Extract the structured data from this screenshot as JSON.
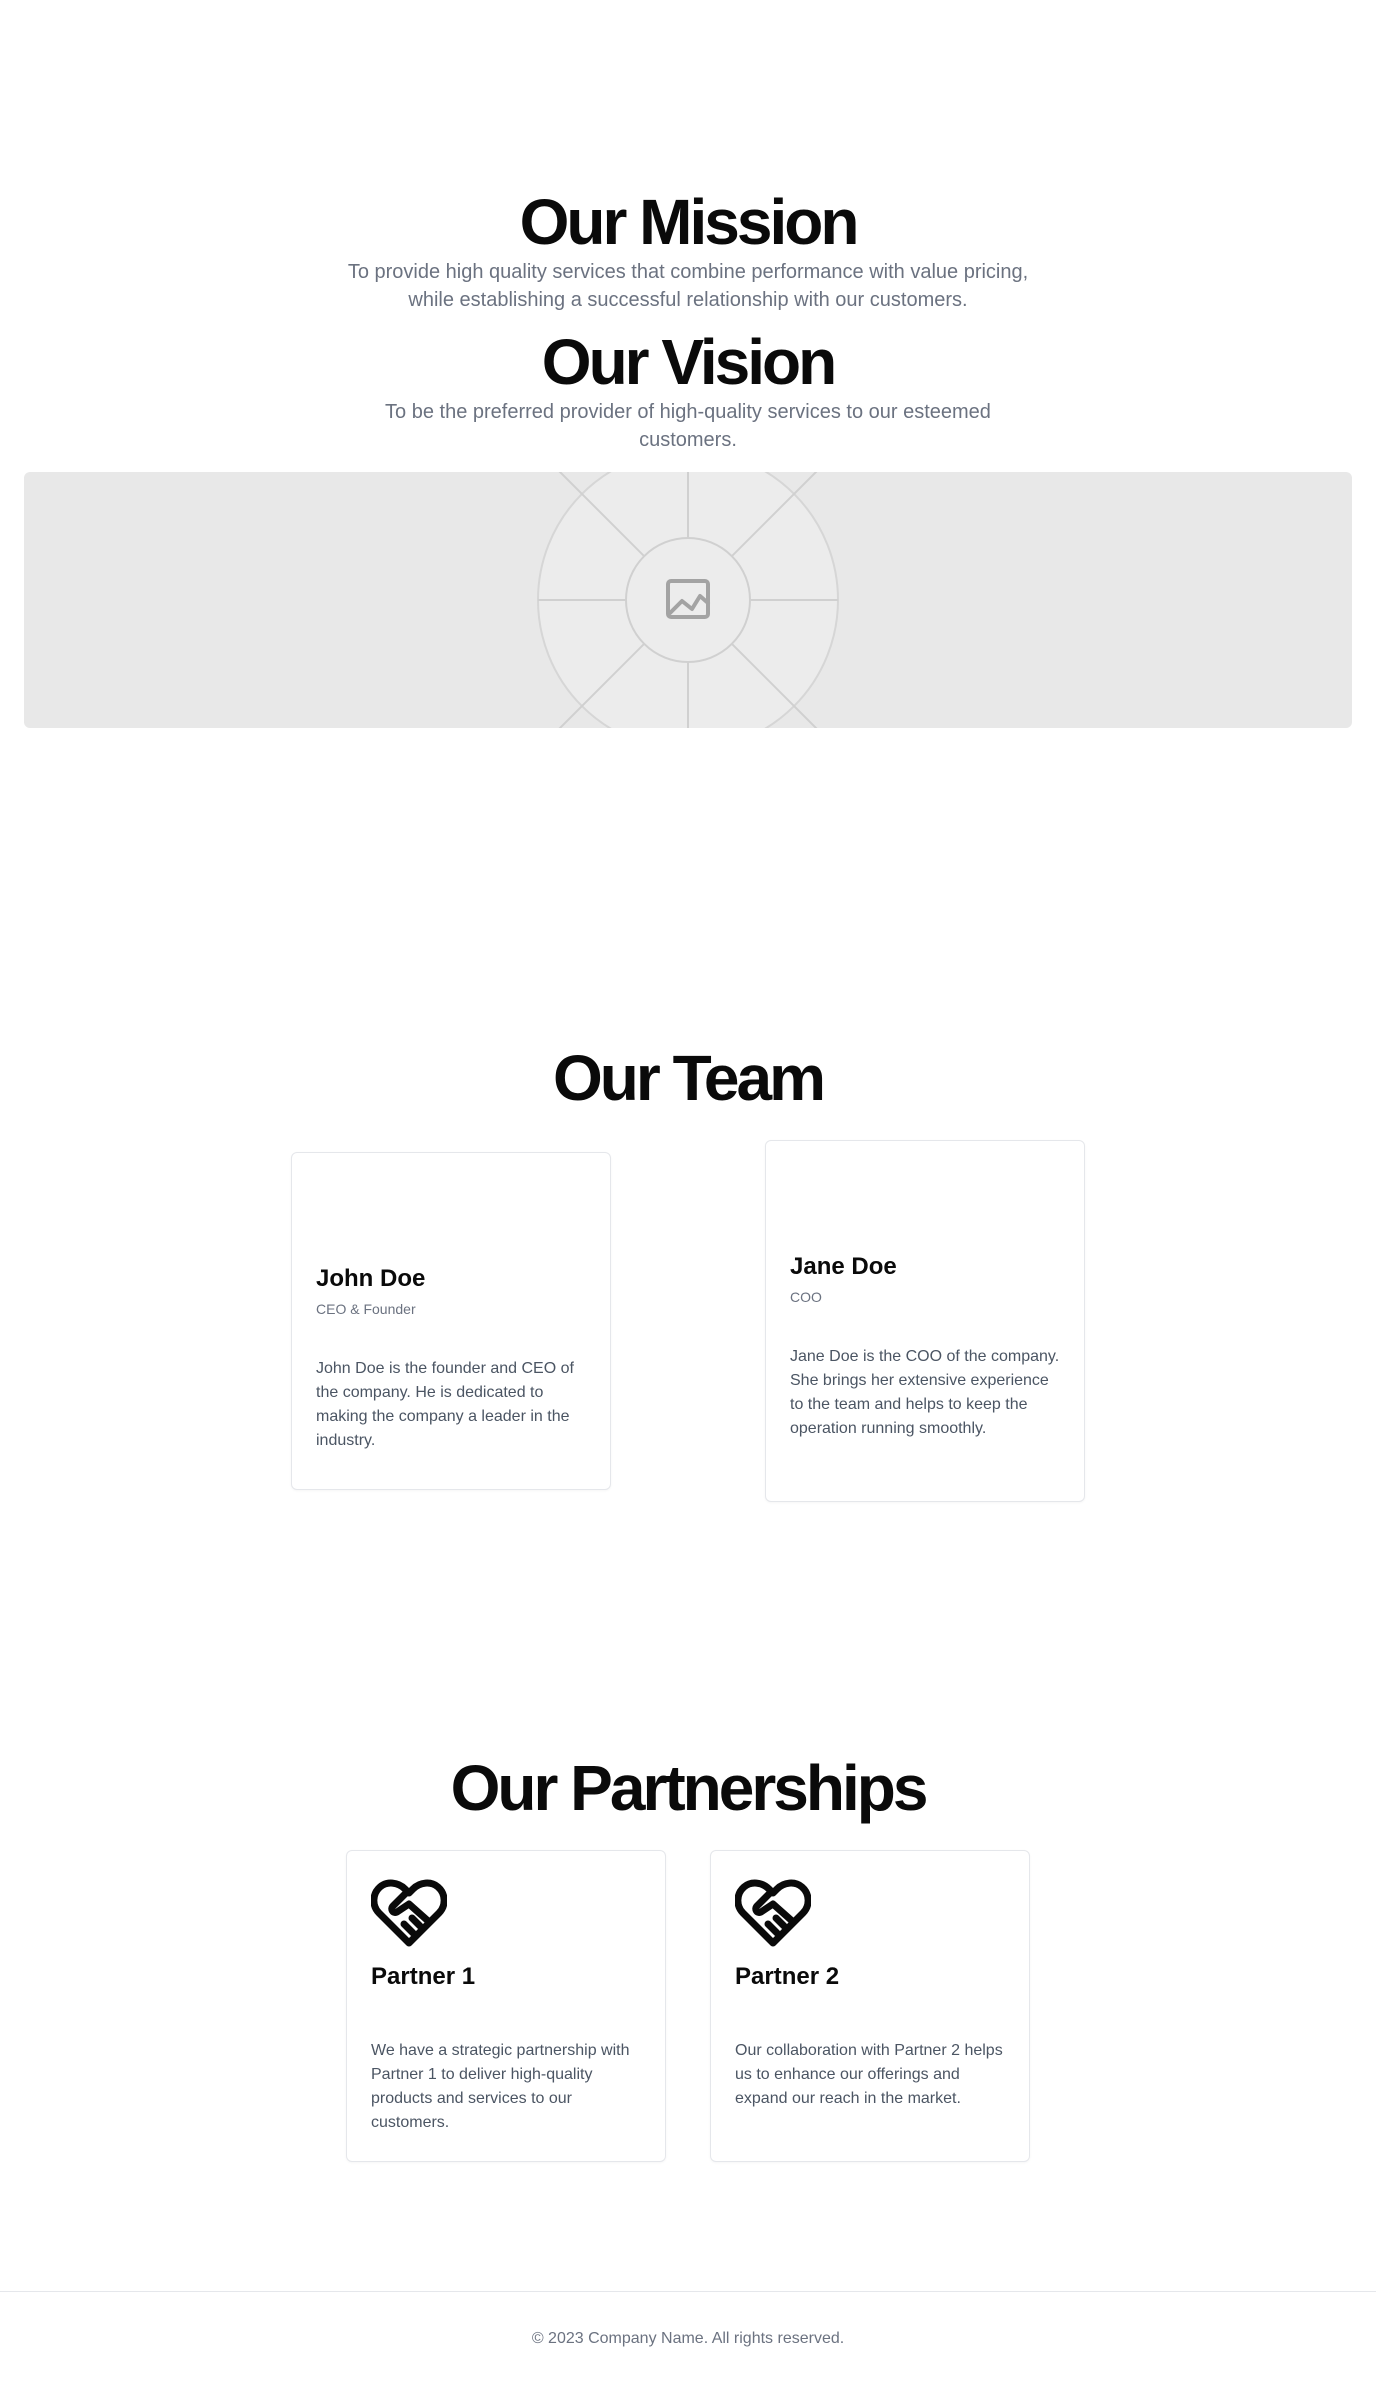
{
  "mission": {
    "title": "Our Mission",
    "text": "To provide high quality services that combine performance with value pricing, while establishing a successful relationship with our customers."
  },
  "vision": {
    "title": "Our Vision",
    "text": "To be the preferred provider of high-quality services to our esteemed customers."
  },
  "hero_image": {
    "icon": "image-icon"
  },
  "team": {
    "title": "Our Team",
    "members": [
      {
        "name": "John Doe",
        "role": "CEO & Founder",
        "bio": "John Doe is the founder and CEO of the company. He is dedicated to making the company a leader in the industry."
      },
      {
        "name": "Jane Doe",
        "role": "COO",
        "bio": "Jane Doe is the COO of the company. She brings her extensive experience to the team and helps to keep the operation running smoothly."
      }
    ]
  },
  "partnerships": {
    "title": "Our Partnerships",
    "partners": [
      {
        "icon": "handshake-heart-icon",
        "name": "Partner 1",
        "text": "We have a strategic partnership with Partner 1 to deliver high-quality products and services to our customers."
      },
      {
        "icon": "handshake-heart-icon",
        "name": "Partner 2",
        "text": "Our collaboration with Partner 2 helps us to enhance our offerings and expand our reach in the market."
      }
    ]
  },
  "footer": {
    "text": "© 2023 Company Name. All rights reserved."
  },
  "colors": {
    "heading": "#0a0a0a",
    "muted_text": "#6b7280",
    "body_text": "#4b5563",
    "placeholder_bg": "#e8e8e8",
    "border": "#e5e7eb"
  }
}
